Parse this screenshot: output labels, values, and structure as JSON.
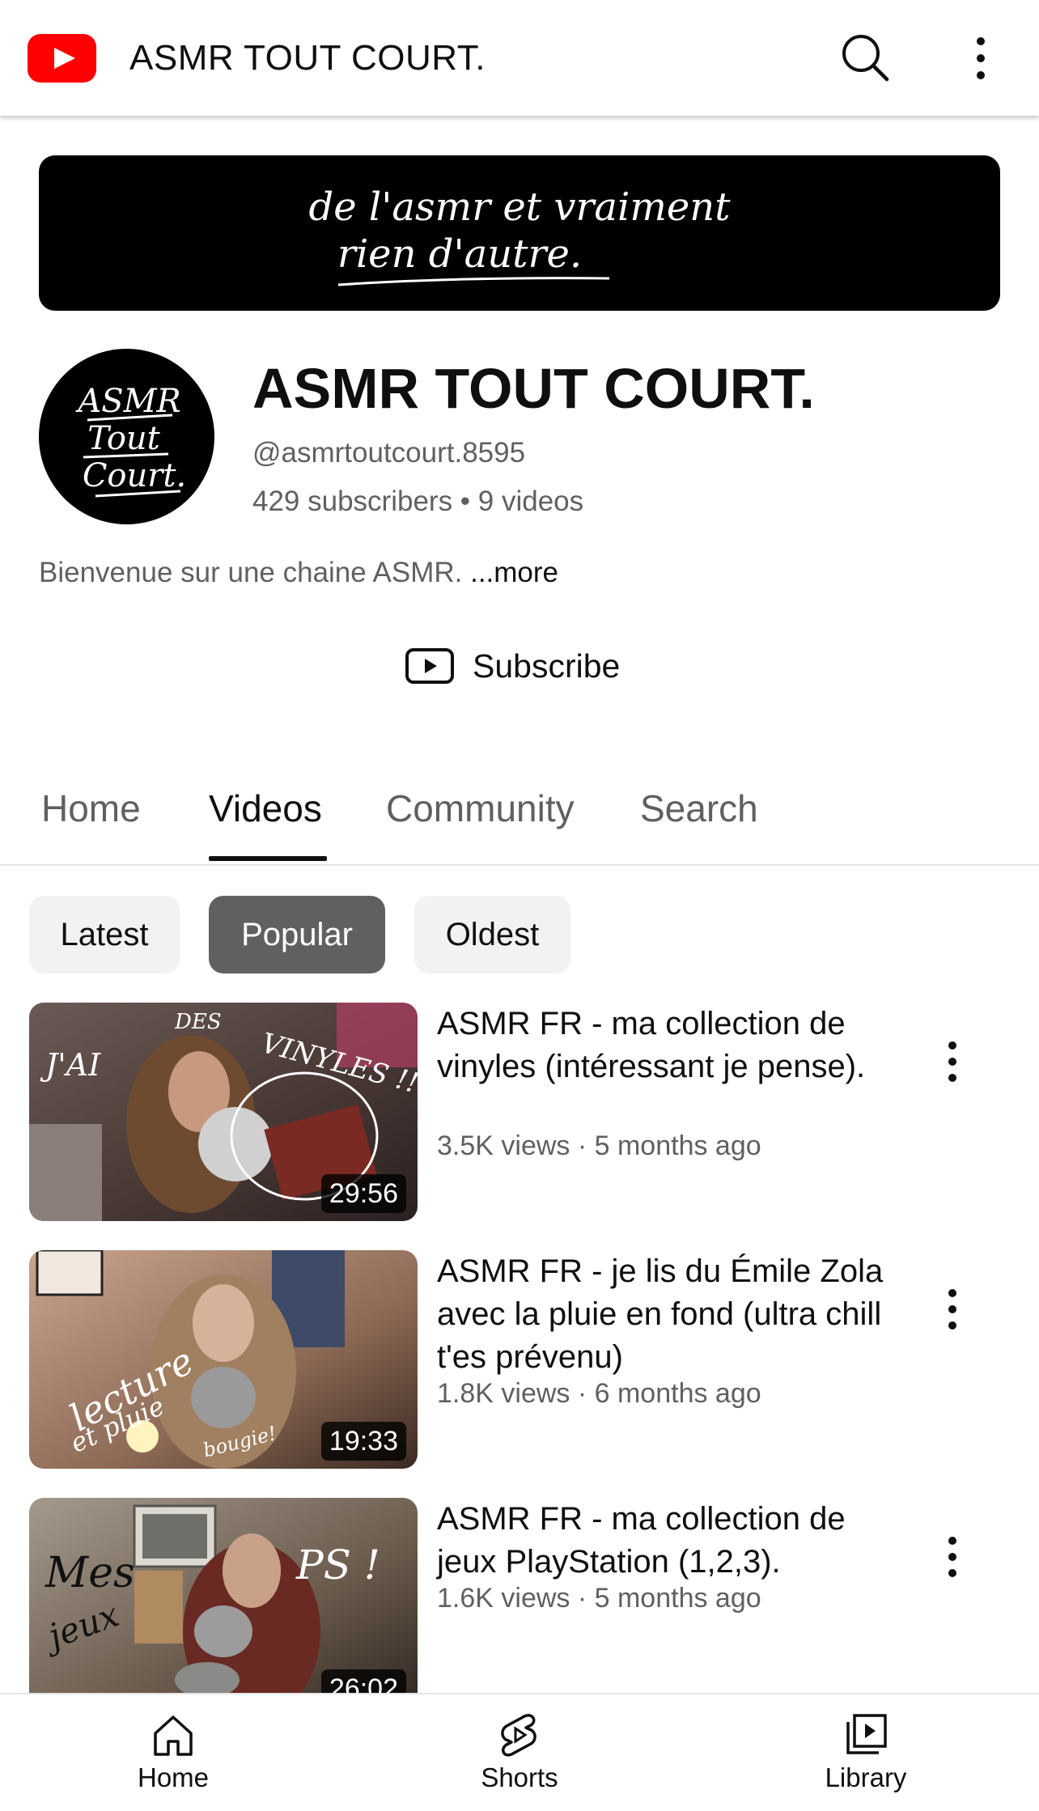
{
  "header": {
    "app_icon": "youtube-logo",
    "title": "ASMR TOUT COURT.",
    "search_icon": "search-icon",
    "more_icon": "more-vert-icon"
  },
  "banner": {
    "line1": "de l'asmr et vraiment",
    "line2": "rien d'autre."
  },
  "channel": {
    "avatar_text": [
      "ASMR",
      "Tout",
      "Court."
    ],
    "name": "ASMR TOUT COURT.",
    "handle": "@asmrtoutcourt.8595",
    "stats": "429 subscribers • 9 videos",
    "description": "Bienvenue sur une chaine ASMR. ",
    "more_label": "...more",
    "subscribe_label": "Subscribe"
  },
  "tabs": [
    {
      "label": "Home",
      "active": false
    },
    {
      "label": "Videos",
      "active": true
    },
    {
      "label": "Community",
      "active": false
    },
    {
      "label": "Search",
      "active": false
    }
  ],
  "chips": [
    {
      "label": "Latest",
      "selected": false
    },
    {
      "label": "Popular",
      "selected": true
    },
    {
      "label": "Oldest",
      "selected": false
    }
  ],
  "videos": [
    {
      "title": "ASMR FR - ma collection de vinyles (intéressant je pense).",
      "meta": "3.5K views · 5 months ago",
      "duration": "29:56",
      "thumb_text": [
        "J'AI",
        "DES",
        "VINYLES !!"
      ]
    },
    {
      "title": "ASMR FR - je lis du Émile Zola avec la pluie en fond (ultra chill t'es prévenu)",
      "meta": "1.8K views · 6 months ago",
      "duration": "19:33",
      "thumb_text": [
        "lecture",
        "et pluie",
        "bougie!"
      ]
    },
    {
      "title": "ASMR FR - ma collection de jeux PlayStation (1,2,3).",
      "meta": "1.6K views · 5 months ago",
      "duration": "26:02",
      "thumb_text": [
        "Mes",
        "jeux",
        "PS !"
      ]
    }
  ],
  "bottom_nav": [
    {
      "label": "Home",
      "icon": "home-icon"
    },
    {
      "label": "Shorts",
      "icon": "shorts-icon"
    },
    {
      "label": "Library",
      "icon": "library-icon"
    }
  ],
  "colors": {
    "brand": "#ff0000",
    "text_primary": "#0f0f0f",
    "text_secondary": "#606060",
    "chip_bg": "#f2f2f2",
    "chip_selected_bg": "#606060"
  }
}
